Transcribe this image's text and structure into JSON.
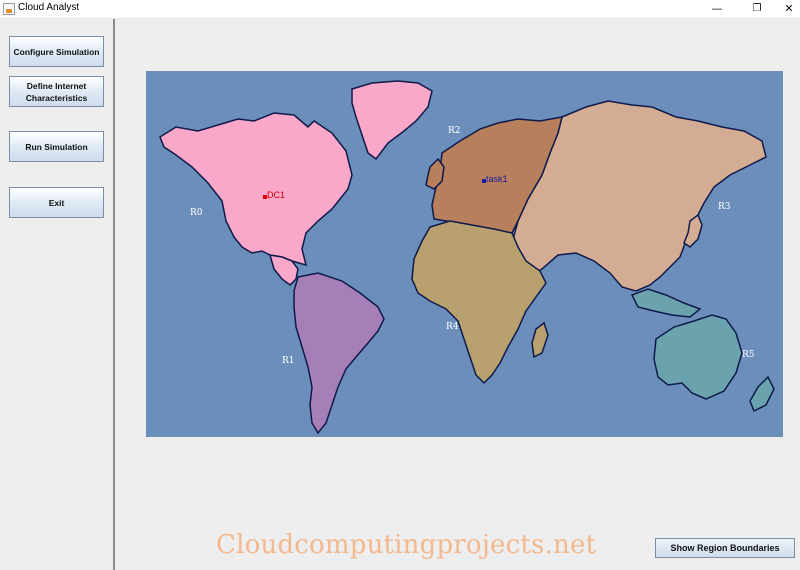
{
  "window": {
    "title": "Cloud Analyst",
    "min_glyph": "—",
    "max_glyph": "❐",
    "close_glyph": "✕"
  },
  "sidebar": {
    "configure_label": "Configure Simulation",
    "define_label": "Define Internet Characteristics",
    "run_label": "Run Simulation",
    "exit_label": "Exit"
  },
  "map": {
    "regions": [
      {
        "id": "R0",
        "label": "R0",
        "color": "#f9a8c9"
      },
      {
        "id": "R1",
        "label": "R1",
        "color": "#a77fb8"
      },
      {
        "id": "R2",
        "label": "R2",
        "color": "#b77f5b"
      },
      {
        "id": "R3",
        "label": "R3",
        "color": "#d4ac93"
      },
      {
        "id": "R4",
        "label": "R4",
        "color": "#b8a06f"
      },
      {
        "id": "R5",
        "label": "R5",
        "color": "#6aa3ad"
      }
    ],
    "ocean_color": "#6b8fba",
    "datacenter": {
      "label": "DC1",
      "color": "#e00000"
    },
    "userbase": {
      "label": "task1",
      "color": "#1a1aa0"
    }
  },
  "watermark": "Cloudcomputingprojects.net",
  "footer": {
    "region_button_label": "Show Region Boundaries"
  }
}
